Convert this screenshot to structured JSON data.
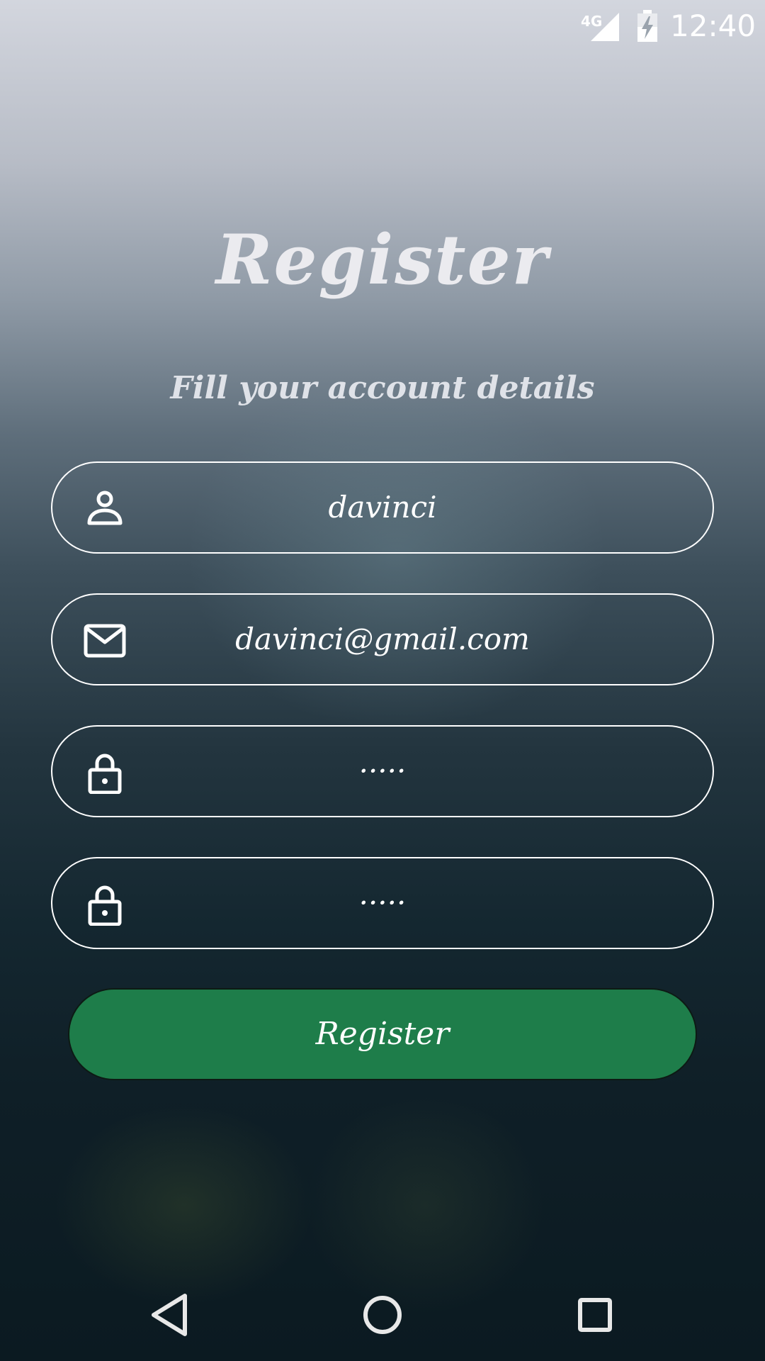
{
  "status_bar": {
    "network": "4G",
    "time": "12:40",
    "icons": [
      "signal-icon",
      "battery-charging-icon"
    ]
  },
  "page": {
    "title": "Register",
    "subtitle": "Fill your account details"
  },
  "form": {
    "username": {
      "value": "davinci",
      "icon": "person-icon"
    },
    "email": {
      "value": "davinci@gmail.com",
      "icon": "mail-icon"
    },
    "password": {
      "value": "·····",
      "icon": "lock-icon"
    },
    "confirm_password": {
      "value": "·····",
      "icon": "lock-icon"
    },
    "submit_label": "Register"
  },
  "nav": {
    "icons": [
      "back-icon",
      "home-icon",
      "recents-icon"
    ]
  },
  "colors": {
    "button": "#1e7d4a",
    "field_border": "#ffffff",
    "text": "#ffffff"
  }
}
